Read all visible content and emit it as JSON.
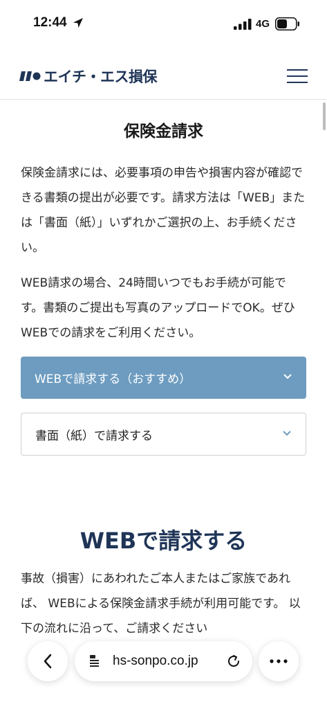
{
  "status_bar": {
    "time": "12:44",
    "network": "4G"
  },
  "header": {
    "logo_text": "エイチ・エス損保",
    "brand_color": "#1f3557"
  },
  "main": {
    "title": "保険金請求",
    "intro_paragraph": "保険金請求には、必要事項の申告や損害内容が確認できる書類の提出が必要です。請求方法は「WEB」または「書面（紙）」いずれかご選択の上、お手続ください。",
    "web_paragraph": "WEB請求の場合、24時間いつでもお手続が可能です。書類のご提出も写真のアップロードでOK。ぜひWEBでの請求をご利用ください。",
    "accordion": [
      {
        "label": "WEBで請求する（おすすめ）",
        "active": true,
        "color": "#6d9cc0"
      },
      {
        "label": "書面（紙）で請求する",
        "active": false
      }
    ],
    "section_title": "WEBで請求する",
    "section_paragraph": "事故（損害）にあわれたご本人またはご家族であれば、 WEBによる保険金請求手続が利用可能です。 以下の流れに沿って、ご請求ください"
  },
  "browser": {
    "url": "hs-sonpo.co.jp"
  }
}
